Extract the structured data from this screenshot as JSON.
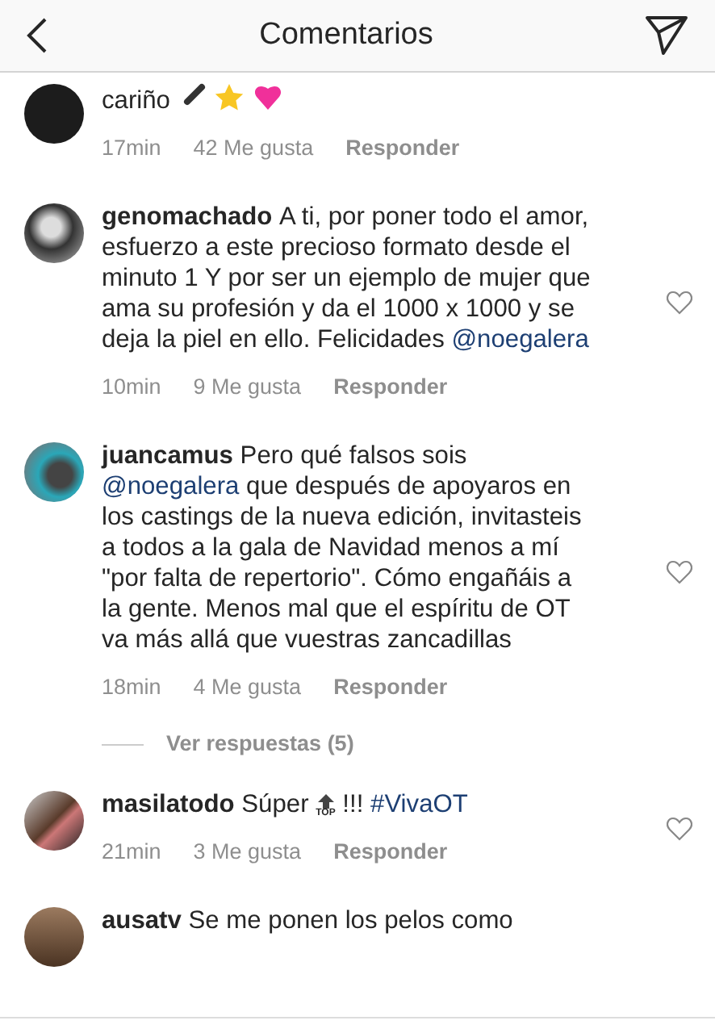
{
  "header": {
    "title": "Comentarios"
  },
  "comments": [
    {
      "segments": [
        {
          "kind": "plain",
          "text": "cariño"
        }
      ],
      "time": "17min",
      "likes": "42 Me gusta",
      "reply": "Responder",
      "heart": false
    },
    {
      "username": "genomachado",
      "segments": [
        {
          "kind": "plain",
          "text": "A ti, por poner todo el amor, esfuerzo a este precioso formato desde el minuto 1 Y por ser un ejemplo de mujer que ama  su profesión y da el 1000 x 1000 y se deja la piel  en ello. Felicidades "
        },
        {
          "kind": "mention",
          "text": "@noegalera"
        }
      ],
      "time": "10min",
      "likes": "9 Me gusta",
      "reply": "Responder",
      "heart": true
    },
    {
      "username": "juancamus",
      "segments": [
        {
          "kind": "plain",
          "text": "Pero qué falsos sois "
        },
        {
          "kind": "mention",
          "text": "@noegalera"
        },
        {
          "kind": "plain",
          "text": " que después de apoyaros en los castings de la nueva edición, invitasteis a todos a la gala de Navidad menos a mí \"por falta de repertorio\". Cómo engañáis a la gente. Menos mal que el espíritu de OT va más allá que vuestras zancadillas"
        }
      ],
      "time": "18min",
      "likes": "4 Me gusta",
      "reply": "Responder",
      "heart": true,
      "replies": "Ver respuestas (5)"
    },
    {
      "username": "masilatodo",
      "segments": [
        {
          "kind": "plain",
          "text": "Súper "
        },
        {
          "kind": "top",
          "text": "TOP"
        },
        {
          "kind": "plain",
          "text": " !!! "
        },
        {
          "kind": "mention",
          "text": "#VivaOT"
        }
      ],
      "time": "21min",
      "likes": "3 Me gusta",
      "reply": "Responder",
      "heart": true
    },
    {
      "username": "ausatv",
      "segments": [
        {
          "kind": "plain",
          "text": "Se me ponen los pelos como"
        }
      ],
      "heart": false
    }
  ]
}
